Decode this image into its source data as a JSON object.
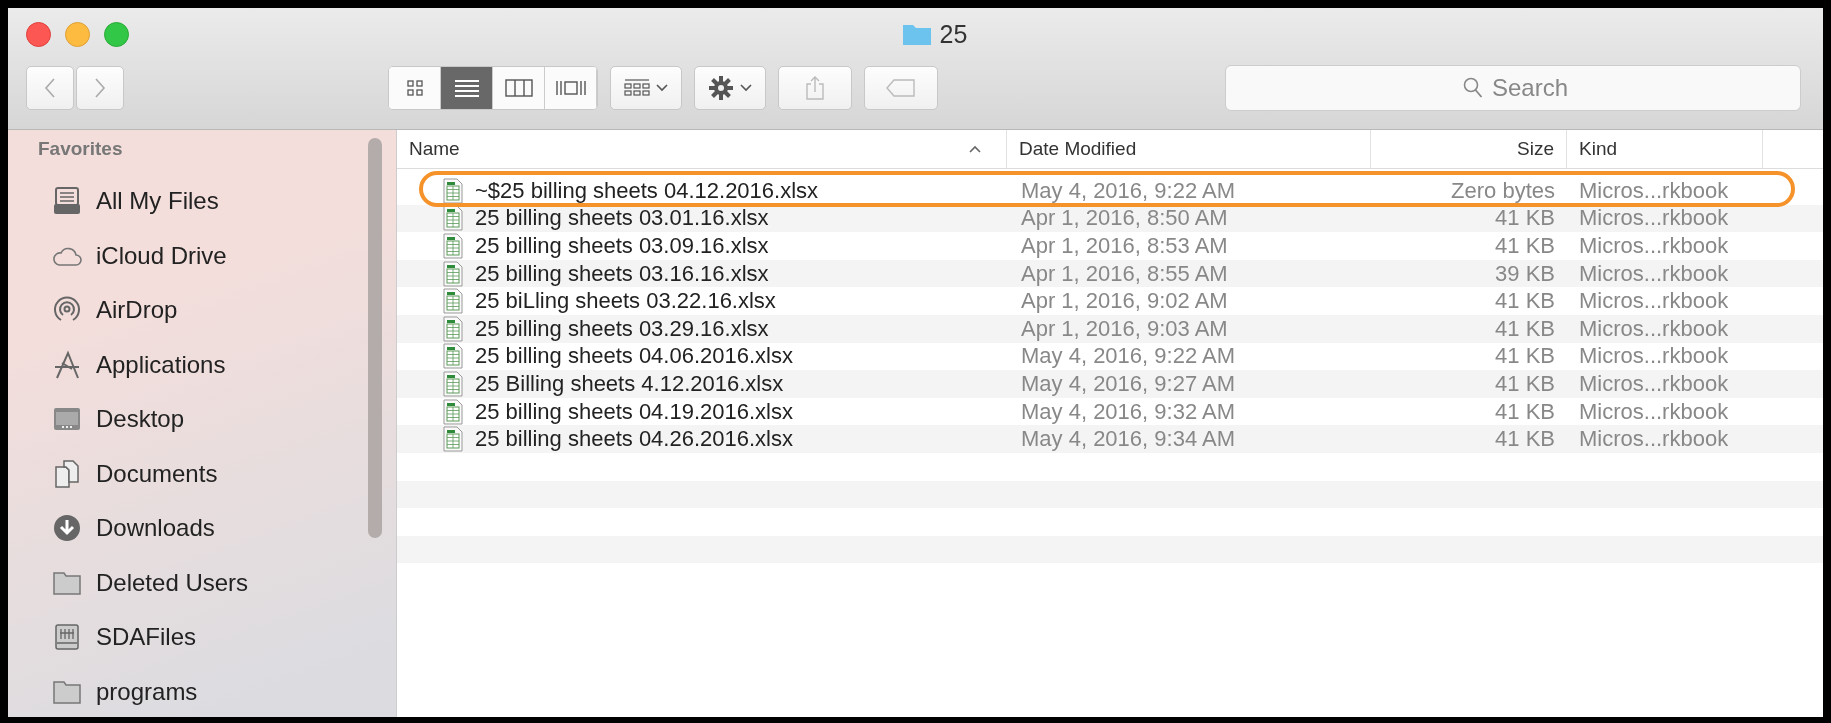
{
  "window": {
    "title": "25"
  },
  "toolbar": {
    "view_modes": [
      {
        "selected": false
      },
      {
        "selected": true
      },
      {
        "selected": false
      },
      {
        "selected": false
      }
    ],
    "search": {
      "placeholder": "Search"
    }
  },
  "sidebar": {
    "heading": "Favorites",
    "items": [
      {
        "label": "All My Files"
      },
      {
        "label": "iCloud Drive"
      },
      {
        "label": "AirDrop"
      },
      {
        "label": "Applications"
      },
      {
        "label": "Desktop"
      },
      {
        "label": "Documents"
      },
      {
        "label": "Downloads"
      },
      {
        "label": "Deleted Users"
      },
      {
        "label": "SDAFiles"
      },
      {
        "label": "programs"
      }
    ]
  },
  "table": {
    "columns": [
      {
        "label": "Name",
        "sorted": true
      },
      {
        "label": "Date Modified",
        "sorted": false
      },
      {
        "label": "Size",
        "sorted": false
      },
      {
        "label": "Kind",
        "sorted": false
      }
    ],
    "rows": [
      {
        "name": "~$25 billing sheets 04.12.2016.xlsx",
        "date": "May 4, 2016, 9:22 AM",
        "size": "Zero bytes",
        "kind": "Micros...rkbook",
        "highlighted": true
      },
      {
        "name": "25 billing sheets 03.01.16.xlsx",
        "date": "Apr 1, 2016, 8:50 AM",
        "size": "41 KB",
        "kind": "Micros...rkbook",
        "highlighted": false
      },
      {
        "name": "25 billing sheets 03.09.16.xlsx",
        "date": "Apr 1, 2016, 8:53 AM",
        "size": "41 KB",
        "kind": "Micros...rkbook",
        "highlighted": false
      },
      {
        "name": "25 billing sheets 03.16.16.xlsx",
        "date": "Apr 1, 2016, 8:55 AM",
        "size": "39 KB",
        "kind": "Micros...rkbook",
        "highlighted": false
      },
      {
        "name": "25 biLling sheets 03.22.16.xlsx",
        "date": "Apr 1, 2016, 9:02 AM",
        "size": "41 KB",
        "kind": "Micros...rkbook",
        "highlighted": false
      },
      {
        "name": "25 billing sheets 03.29.16.xlsx",
        "date": "Apr 1, 2016, 9:03 AM",
        "size": "41 KB",
        "kind": "Micros...rkbook",
        "highlighted": false
      },
      {
        "name": "25 billing sheets 04.06.2016.xlsx",
        "date": "May 4, 2016, 9:22 AM",
        "size": "41 KB",
        "kind": "Micros...rkbook",
        "highlighted": false
      },
      {
        "name": "25 Billing sheets 4.12.2016.xlsx",
        "date": "May 4, 2016, 9:27 AM",
        "size": "41 KB",
        "kind": "Micros...rkbook",
        "highlighted": false
      },
      {
        "name": "25 billing sheets 04.19.2016.xlsx",
        "date": "May 4, 2016, 9:32 AM",
        "size": "41 KB",
        "kind": "Micros...rkbook",
        "highlighted": false
      },
      {
        "name": "25 billing sheets 04.26.2016.xlsx",
        "date": "May 4, 2016, 9:34 AM",
        "size": "41 KB",
        "kind": "Micros...rkbook",
        "highlighted": false
      }
    ]
  }
}
